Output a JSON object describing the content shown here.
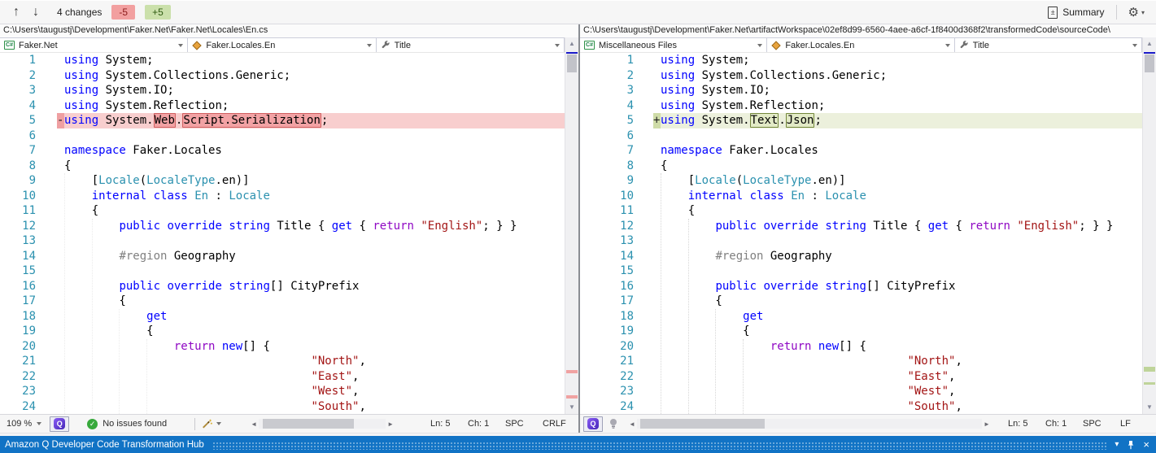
{
  "toolbar": {
    "changes": "4 changes",
    "removed": "-5",
    "added": "+5",
    "summary": "Summary"
  },
  "icons": {
    "prev": "↑",
    "next": "↓",
    "gear": "⚙",
    "caret": "▾",
    "plusminus": "±",
    "csharp": "C#",
    "check": "✓",
    "q_letter": "Q",
    "scroll_up": "▲",
    "scroll_down": "▼",
    "scroll_left": "◄",
    "scroll_right": "►",
    "close": "×"
  },
  "bottom": {
    "title": "Amazon Q Developer Code Transformation Hub"
  },
  "colors": {
    "deleted_line_bg": "#F8CECE",
    "inserted_line_bg": "#ECF0DC",
    "deleted_word_border": "#D06060",
    "inserted_word_border": "#74883C",
    "keyword": "#0000FF",
    "type": "#2B91AF",
    "string": "#A31515",
    "control_keyword": "#8F08C4",
    "bottom_bar": "#1173C5"
  },
  "left_pane": {
    "path": "C:\\Users\\taugustj\\Development\\Faker.Net\\Faker.Net\\Locales\\En.cs",
    "nav_project": "Faker.Net",
    "nav_type": "Faker.Locales.En",
    "nav_member": "Title",
    "status": {
      "zoom": "109 %",
      "issues": "No issues found",
      "line": "Ln: 5",
      "col": "Ch: 1",
      "mode": "SPC",
      "eol": "CRLF"
    },
    "lines": [
      {
        "n": "1",
        "m": "",
        "bg": "",
        "t": [
          [
            "k",
            "using"
          ],
          [
            "p",
            " System;"
          ]
        ]
      },
      {
        "n": "2",
        "m": "",
        "bg": "",
        "t": [
          [
            "k",
            "using"
          ],
          [
            "p",
            " System.Collections.Generic;"
          ]
        ]
      },
      {
        "n": "3",
        "m": "",
        "bg": "",
        "t": [
          [
            "k",
            "using"
          ],
          [
            "p",
            " System.IO;"
          ]
        ]
      },
      {
        "n": "4",
        "m": "",
        "bg": "",
        "t": [
          [
            "k",
            "using"
          ],
          [
            "p",
            " System.Reflection;"
          ]
        ]
      },
      {
        "n": "5",
        "m": "-",
        "bg": "del",
        "t": [
          [
            "k",
            "using"
          ],
          [
            "p",
            " System."
          ],
          [
            "dbox",
            "Web"
          ],
          [
            "p",
            "."
          ],
          [
            "dbox",
            "Script.Serialization"
          ],
          [
            "p",
            ";"
          ]
        ]
      },
      {
        "n": "6",
        "m": "",
        "bg": "",
        "t": []
      },
      {
        "n": "7",
        "m": "",
        "bg": "",
        "t": [
          [
            "k",
            "namespace"
          ],
          [
            "p",
            " Faker.Locales"
          ]
        ]
      },
      {
        "n": "8",
        "m": "",
        "bg": "",
        "t": [
          [
            "p",
            "{"
          ]
        ]
      },
      {
        "n": "9",
        "m": "",
        "bg": "",
        "t": [
          [
            "p",
            "    ["
          ],
          [
            "ty",
            "Locale"
          ],
          [
            "p",
            "("
          ],
          [
            "ty",
            "LocaleType"
          ],
          [
            "p",
            ".en)]"
          ]
        ]
      },
      {
        "n": "10",
        "m": "",
        "bg": "",
        "t": [
          [
            "p",
            "    "
          ],
          [
            "k",
            "internal"
          ],
          [
            "p",
            " "
          ],
          [
            "k",
            "class"
          ],
          [
            "p",
            " "
          ],
          [
            "ty",
            "En"
          ],
          [
            "p",
            " : "
          ],
          [
            "ty",
            "Locale"
          ]
        ]
      },
      {
        "n": "11",
        "m": "",
        "bg": "",
        "t": [
          [
            "p",
            "    {"
          ]
        ]
      },
      {
        "n": "12",
        "m": "",
        "bg": "",
        "t": [
          [
            "p",
            "        "
          ],
          [
            "k",
            "public"
          ],
          [
            "p",
            " "
          ],
          [
            "k",
            "override"
          ],
          [
            "p",
            " "
          ],
          [
            "k",
            "string"
          ],
          [
            "p",
            " Title { "
          ],
          [
            "k",
            "get"
          ],
          [
            "p",
            " { "
          ],
          [
            "r",
            "return"
          ],
          [
            "p",
            " "
          ],
          [
            "s",
            "\"English\""
          ],
          [
            "p",
            "; } }"
          ]
        ]
      },
      {
        "n": "13",
        "m": "",
        "bg": "",
        "t": []
      },
      {
        "n": "14",
        "m": "",
        "bg": "",
        "t": [
          [
            "p",
            "        "
          ],
          [
            "g",
            "#region"
          ],
          [
            "p",
            " Geography"
          ]
        ]
      },
      {
        "n": "15",
        "m": "",
        "bg": "",
        "t": []
      },
      {
        "n": "16",
        "m": "",
        "bg": "",
        "t": [
          [
            "p",
            "        "
          ],
          [
            "k",
            "public"
          ],
          [
            "p",
            " "
          ],
          [
            "k",
            "override"
          ],
          [
            "p",
            " "
          ],
          [
            "k",
            "string"
          ],
          [
            "p",
            "[] CityPrefix"
          ]
        ]
      },
      {
        "n": "17",
        "m": "",
        "bg": "",
        "t": [
          [
            "p",
            "        {"
          ]
        ]
      },
      {
        "n": "18",
        "m": "",
        "bg": "",
        "t": [
          [
            "p",
            "            "
          ],
          [
            "k",
            "get"
          ]
        ]
      },
      {
        "n": "19",
        "m": "",
        "bg": "",
        "t": [
          [
            "p",
            "            {"
          ]
        ]
      },
      {
        "n": "20",
        "m": "",
        "bg": "",
        "t": [
          [
            "p",
            "                "
          ],
          [
            "r",
            "return"
          ],
          [
            "p",
            " "
          ],
          [
            "k",
            "new"
          ],
          [
            "p",
            "[] {"
          ]
        ]
      },
      {
        "n": "21",
        "m": "",
        "bg": "",
        "t": [
          [
            "p",
            "                                    "
          ],
          [
            "s",
            "\"North\""
          ],
          [
            "p",
            ","
          ]
        ]
      },
      {
        "n": "22",
        "m": "",
        "bg": "",
        "t": [
          [
            "p",
            "                                    "
          ],
          [
            "s",
            "\"East\""
          ],
          [
            "p",
            ","
          ]
        ]
      },
      {
        "n": "23",
        "m": "",
        "bg": "",
        "t": [
          [
            "p",
            "                                    "
          ],
          [
            "s",
            "\"West\""
          ],
          [
            "p",
            ","
          ]
        ]
      },
      {
        "n": "24",
        "m": "",
        "bg": "",
        "t": [
          [
            "p",
            "                                    "
          ],
          [
            "s",
            "\"South\""
          ],
          [
            "p",
            ","
          ]
        ]
      }
    ]
  },
  "right_pane": {
    "path": "C:\\Users\\taugustj\\Development\\Faker.Net\\artifactWorkspace\\02ef8d99-6560-4aee-a6cf-1f8400d368f2\\transformedCode\\sourceCode\\",
    "nav_project": "Miscellaneous Files",
    "nav_type": "Faker.Locales.En",
    "nav_member": "Title",
    "status": {
      "line": "Ln: 5",
      "col": "Ch: 1",
      "mode": "SPC",
      "eol": "LF"
    },
    "lines": [
      {
        "n": "1",
        "m": "",
        "bg": "",
        "t": [
          [
            "k",
            "using"
          ],
          [
            "p",
            " System;"
          ]
        ]
      },
      {
        "n": "2",
        "m": "",
        "bg": "",
        "t": [
          [
            "k",
            "using"
          ],
          [
            "p",
            " System.Collections.Generic;"
          ]
        ]
      },
      {
        "n": "3",
        "m": "",
        "bg": "",
        "t": [
          [
            "k",
            "using"
          ],
          [
            "p",
            " System.IO;"
          ]
        ]
      },
      {
        "n": "4",
        "m": "",
        "bg": "",
        "t": [
          [
            "k",
            "using"
          ],
          [
            "p",
            " System.Reflection;"
          ]
        ]
      },
      {
        "n": "5",
        "m": "+",
        "bg": "ins",
        "t": [
          [
            "k",
            "using"
          ],
          [
            "p",
            " System."
          ],
          [
            "ibox",
            "Text"
          ],
          [
            "p",
            "."
          ],
          [
            "ibox",
            "Json"
          ],
          [
            "p",
            ";"
          ]
        ]
      },
      {
        "n": "6",
        "m": "",
        "bg": "",
        "t": []
      },
      {
        "n": "7",
        "m": "",
        "bg": "",
        "t": [
          [
            "k",
            "namespace"
          ],
          [
            "p",
            " Faker.Locales"
          ]
        ]
      },
      {
        "n": "8",
        "m": "",
        "bg": "",
        "t": [
          [
            "p",
            "{"
          ]
        ]
      },
      {
        "n": "9",
        "m": "",
        "bg": "",
        "t": [
          [
            "p",
            "    ["
          ],
          [
            "ty",
            "Locale"
          ],
          [
            "p",
            "("
          ],
          [
            "ty",
            "LocaleType"
          ],
          [
            "p",
            ".en)]"
          ]
        ]
      },
      {
        "n": "10",
        "m": "",
        "bg": "",
        "t": [
          [
            "p",
            "    "
          ],
          [
            "k",
            "internal"
          ],
          [
            "p",
            " "
          ],
          [
            "k",
            "class"
          ],
          [
            "p",
            " "
          ],
          [
            "ty",
            "En"
          ],
          [
            "p",
            " : "
          ],
          [
            "ty",
            "Locale"
          ]
        ]
      },
      {
        "n": "11",
        "m": "",
        "bg": "",
        "t": [
          [
            "p",
            "    {"
          ]
        ]
      },
      {
        "n": "12",
        "m": "",
        "bg": "",
        "t": [
          [
            "p",
            "        "
          ],
          [
            "k",
            "public"
          ],
          [
            "p",
            " "
          ],
          [
            "k",
            "override"
          ],
          [
            "p",
            " "
          ],
          [
            "k",
            "string"
          ],
          [
            "p",
            " Title { "
          ],
          [
            "k",
            "get"
          ],
          [
            "p",
            " { "
          ],
          [
            "r",
            "return"
          ],
          [
            "p",
            " "
          ],
          [
            "s",
            "\"English\""
          ],
          [
            "p",
            "; } }"
          ]
        ]
      },
      {
        "n": "13",
        "m": "",
        "bg": "",
        "t": []
      },
      {
        "n": "14",
        "m": "",
        "bg": "",
        "t": [
          [
            "p",
            "        "
          ],
          [
            "g",
            "#region"
          ],
          [
            "p",
            " Geography"
          ]
        ]
      },
      {
        "n": "15",
        "m": "",
        "bg": "",
        "t": []
      },
      {
        "n": "16",
        "m": "",
        "bg": "",
        "t": [
          [
            "p",
            "        "
          ],
          [
            "k",
            "public"
          ],
          [
            "p",
            " "
          ],
          [
            "k",
            "override"
          ],
          [
            "p",
            " "
          ],
          [
            "k",
            "string"
          ],
          [
            "p",
            "[] CityPrefix"
          ]
        ]
      },
      {
        "n": "17",
        "m": "",
        "bg": "",
        "t": [
          [
            "p",
            "        {"
          ]
        ]
      },
      {
        "n": "18",
        "m": "",
        "bg": "",
        "t": [
          [
            "p",
            "            "
          ],
          [
            "k",
            "get"
          ]
        ]
      },
      {
        "n": "19",
        "m": "",
        "bg": "",
        "t": [
          [
            "p",
            "            {"
          ]
        ]
      },
      {
        "n": "20",
        "m": "",
        "bg": "",
        "t": [
          [
            "p",
            "                "
          ],
          [
            "r",
            "return"
          ],
          [
            "p",
            " "
          ],
          [
            "k",
            "new"
          ],
          [
            "p",
            "[] {"
          ]
        ]
      },
      {
        "n": "21",
        "m": "",
        "bg": "",
        "t": [
          [
            "p",
            "                                    "
          ],
          [
            "s",
            "\"North\""
          ],
          [
            "p",
            ","
          ]
        ]
      },
      {
        "n": "22",
        "m": "",
        "bg": "",
        "t": [
          [
            "p",
            "                                    "
          ],
          [
            "s",
            "\"East\""
          ],
          [
            "p",
            ","
          ]
        ]
      },
      {
        "n": "23",
        "m": "",
        "bg": "",
        "t": [
          [
            "p",
            "                                    "
          ],
          [
            "s",
            "\"West\""
          ],
          [
            "p",
            ","
          ]
        ]
      },
      {
        "n": "24",
        "m": "",
        "bg": "",
        "t": [
          [
            "p",
            "                                    "
          ],
          [
            "s",
            "\"South\""
          ],
          [
            "p",
            ","
          ]
        ]
      }
    ]
  }
}
